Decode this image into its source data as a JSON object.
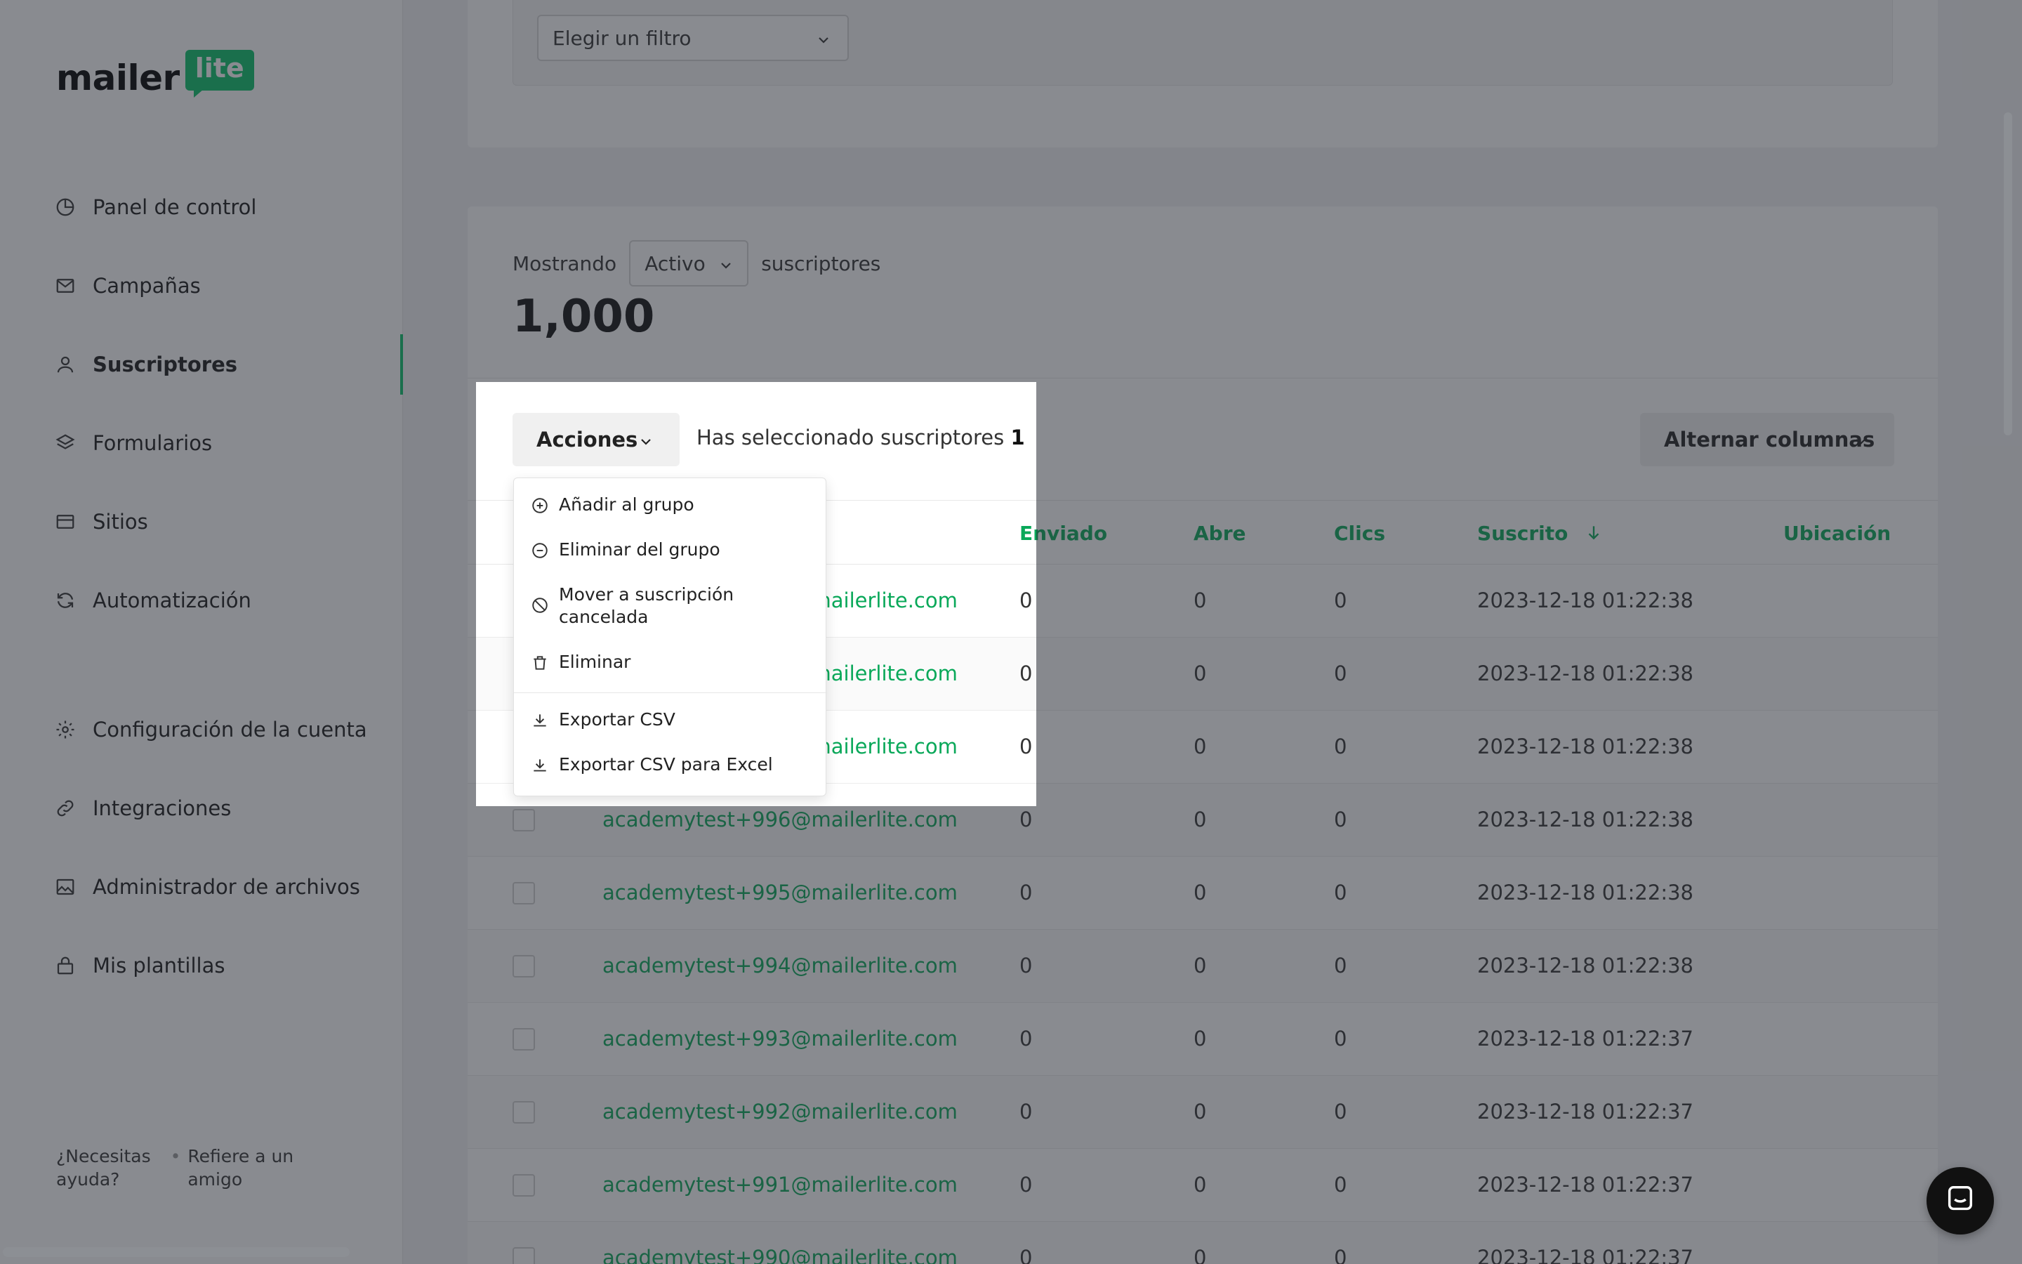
{
  "brand": {
    "word": "mailer",
    "badge": "lite",
    "accent": "#09c269"
  },
  "sidebar": {
    "items": [
      {
        "label": "Panel de control",
        "icon": "pie-chart-icon"
      },
      {
        "label": "Campañas",
        "icon": "mail-icon"
      },
      {
        "label": "Suscriptores",
        "icon": "user-icon",
        "active": true
      },
      {
        "label": "Formularios",
        "icon": "layers-icon"
      },
      {
        "label": "Sitios",
        "icon": "browser-icon"
      },
      {
        "label": "Automatización",
        "icon": "refresh-icon"
      },
      {
        "label": "Configuración de la cuenta",
        "icon": "gear-icon"
      },
      {
        "label": "Integraciones",
        "icon": "link-icon"
      },
      {
        "label": "Administrador de archivos",
        "icon": "image-icon"
      },
      {
        "label": "Mis plantillas",
        "icon": "lock-icon"
      }
    ],
    "footer": {
      "help_line1": "¿Necesitas",
      "help_line2": "ayuda?",
      "refer_line1": "Refiere a un",
      "refer_line2": "amigo"
    }
  },
  "filter": {
    "placeholder": "Elegir un filtro"
  },
  "summary": {
    "showing": "Mostrando",
    "status": "Activo",
    "suffix": "suscriptores",
    "count": "1,000"
  },
  "toolbar": {
    "actions_label": "Acciones",
    "selected_text": "Has seleccionado suscriptores",
    "selected_count": "1",
    "toggle_columns": "Alternar columnas"
  },
  "actions_menu": [
    {
      "label": "Añadir al grupo",
      "icon": "plus-circle-icon"
    },
    {
      "label": "Eliminar del grupo",
      "icon": "minus-circle-icon"
    },
    {
      "label_line1": "Mover a suscripción",
      "label_line2": "cancelada",
      "icon": "ban-icon"
    },
    {
      "label": "Eliminar",
      "icon": "trash-icon"
    },
    {
      "label": "Exportar CSV",
      "icon": "download-icon"
    },
    {
      "label": "Exportar CSV para Excel",
      "icon": "download-icon"
    }
  ],
  "table": {
    "columns": {
      "sent": "Enviado",
      "opens": "Abre",
      "clicks": "Clics",
      "subscribed": "Suscrito",
      "location": "Ubicación"
    },
    "rows": [
      {
        "email": "academytest+999@mailerlite.com",
        "sent": "0",
        "opens": "0",
        "clicks": "0",
        "subscribed": "2023-12-18 01:22:38"
      },
      {
        "email": "academytest+998@mailerlite.com",
        "sent": "0",
        "opens": "0",
        "clicks": "0",
        "subscribed": "2023-12-18 01:22:38"
      },
      {
        "email": "academytest+997@mailerlite.com",
        "sent": "0",
        "opens": "0",
        "clicks": "0",
        "subscribed": "2023-12-18 01:22:38"
      },
      {
        "email": "academytest+996@mailerlite.com",
        "sent": "0",
        "opens": "0",
        "clicks": "0",
        "subscribed": "2023-12-18 01:22:38"
      },
      {
        "email": "academytest+995@mailerlite.com",
        "sent": "0",
        "opens": "0",
        "clicks": "0",
        "subscribed": "2023-12-18 01:22:38"
      },
      {
        "email": "academytest+994@mailerlite.com",
        "sent": "0",
        "opens": "0",
        "clicks": "0",
        "subscribed": "2023-12-18 01:22:38"
      },
      {
        "email": "academytest+993@mailerlite.com",
        "sent": "0",
        "opens": "0",
        "clicks": "0",
        "subscribed": "2023-12-18 01:22:37"
      },
      {
        "email": "academytest+992@mailerlite.com",
        "sent": "0",
        "opens": "0",
        "clicks": "0",
        "subscribed": "2023-12-18 01:22:37"
      },
      {
        "email": "academytest+991@mailerlite.com",
        "sent": "0",
        "opens": "0",
        "clicks": "0",
        "subscribed": "2023-12-18 01:22:37"
      },
      {
        "email": "academytest+990@mailerlite.com",
        "sent": "0",
        "opens": "0",
        "clicks": "0",
        "subscribed": "2023-12-18 01:22:37"
      }
    ]
  }
}
